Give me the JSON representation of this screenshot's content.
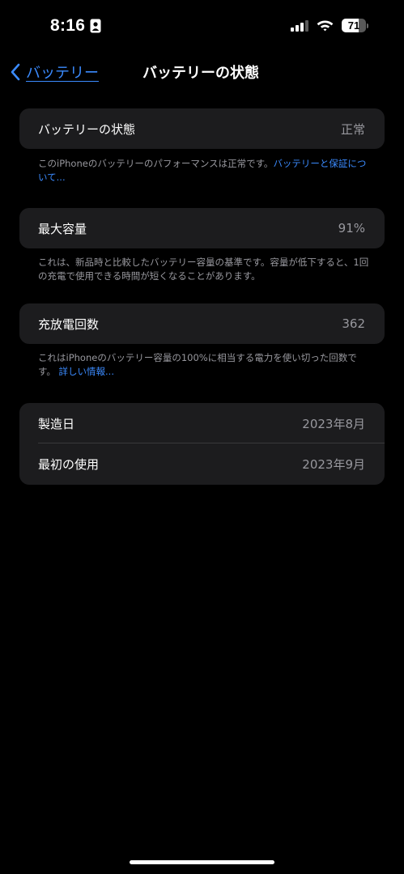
{
  "status_bar": {
    "time": "8:16",
    "battery_level": "71",
    "battery_fraction": 0.71
  },
  "nav": {
    "back_label": "バッテリー",
    "title": "バッテリーの状態"
  },
  "sections": {
    "health": {
      "label": "バッテリーの状態",
      "value": "正常",
      "footnote": "このiPhoneのバッテリーのパフォーマンスは正常です。",
      "link": "バッテリーと保証について..."
    },
    "capacity": {
      "label": "最大容量",
      "value": "91%",
      "footnote": "これは、新品時と比較したバッテリー容量の基準です。容量が低下すると、1回の充電で使用できる時間が短くなることがあります。"
    },
    "cycle": {
      "label": "充放電回数",
      "value": "362",
      "footnote": "これはiPhoneのバッテリー容量の100%に相当する電力を使い切った回数です。",
      "link": "詳しい情報..."
    },
    "dates": {
      "manufacture_label": "製造日",
      "manufacture_value": "2023年8月",
      "first_use_label": "最初の使用",
      "first_use_value": "2023年9月"
    }
  },
  "colors": {
    "background": "#000000",
    "card": "#1c1c1e",
    "accent": "#3b8bff",
    "secondary_text": "#98989e"
  },
  "icons": [
    "id-badge-icon",
    "cellular-signal-icon",
    "wifi-icon",
    "battery-icon",
    "chevron-left-icon"
  ]
}
